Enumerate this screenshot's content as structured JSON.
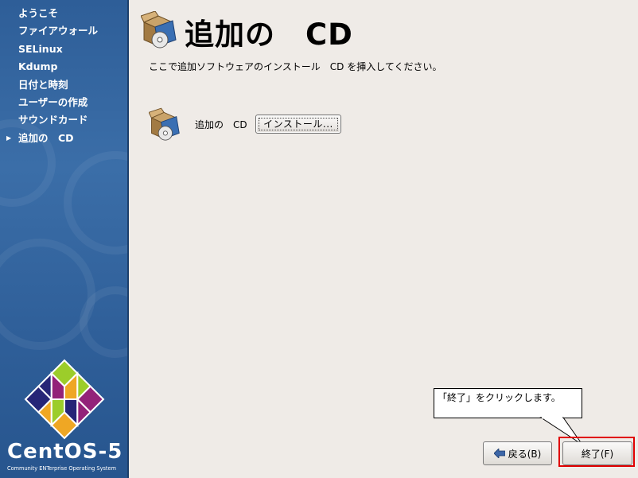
{
  "sidebar": {
    "items": [
      {
        "label": "ようこそ",
        "current": false
      },
      {
        "label": "ファイアウォール",
        "current": false
      },
      {
        "label": "SELinux",
        "current": false
      },
      {
        "label": "Kdump",
        "current": false
      },
      {
        "label": "日付と時刻",
        "current": false
      },
      {
        "label": "ユーザーの作成",
        "current": false
      },
      {
        "label": "サウンドカード",
        "current": false
      },
      {
        "label": "追加の　CD",
        "current": true
      }
    ],
    "brand": "CentOS-5",
    "tagline": "Community ENTerprise Operating System"
  },
  "main": {
    "title": "追加の　CD",
    "description": "ここで追加ソフトウェアのインストール　CD を挿入してください。",
    "cd_label": "追加の　CD",
    "install_button": "インストール..."
  },
  "callout": {
    "text": "「終了」をクリックします。"
  },
  "footer": {
    "back_label": "戻る(B)",
    "finish_label": "終了(F)"
  },
  "colors": {
    "sidebar_bg": "#2e5e98",
    "window_bg": "#efebe7",
    "highlight": "#e00000"
  }
}
